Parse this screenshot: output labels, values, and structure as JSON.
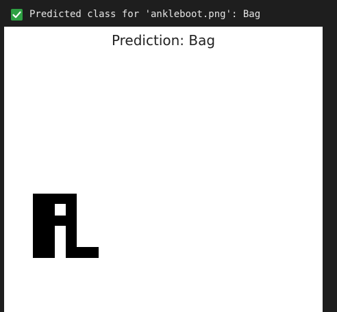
{
  "output": {
    "status_icon": "checkmark-icon",
    "status_color": "#2ea043",
    "message": "Predicted class for 'ankleboot.png': Bag"
  },
  "figure": {
    "title": "Prediction: Bag",
    "background": "#ffffff",
    "pixel_color": "#000000"
  }
}
